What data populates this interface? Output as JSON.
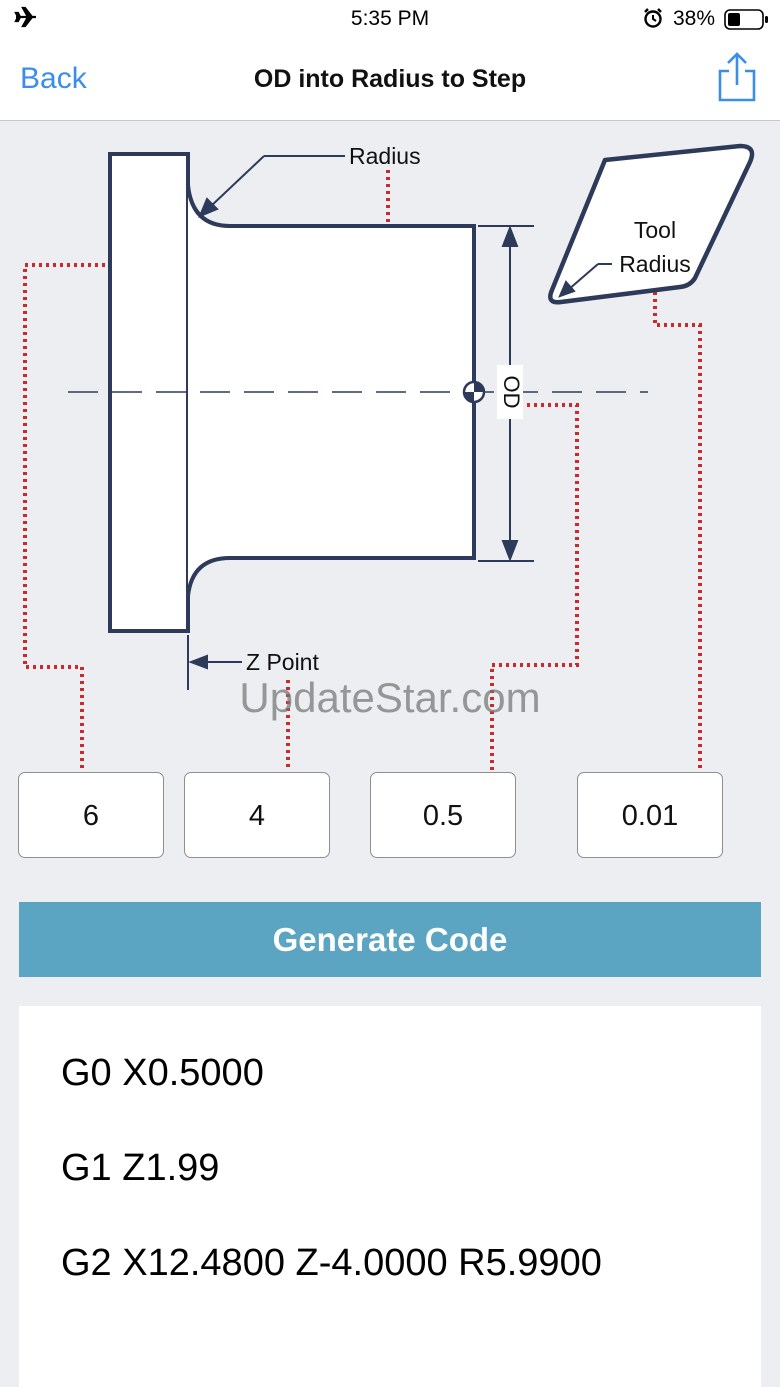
{
  "status_bar": {
    "time": "5:35 PM",
    "battery_percent": "38%",
    "battery_level": 0.38,
    "icons": [
      "airplane-icon",
      "alarm-icon",
      "battery-icon"
    ]
  },
  "nav": {
    "back_label": "Back",
    "title": "OD into Radius to Step",
    "share_icon": "share-icon",
    "accent_color": "#3a8ee6"
  },
  "diagram": {
    "labels": {
      "radius": "Radius",
      "tool": "Tool",
      "tool_radius": "Radius",
      "od": "OD",
      "z_point": "Z Point"
    },
    "line_color": "#2e3a59",
    "leader_color": "#cc2a2a"
  },
  "inputs": [
    {
      "value": "6"
    },
    {
      "value": "4"
    },
    {
      "value": "0.5"
    },
    {
      "value": "0.01"
    }
  ],
  "watermark": "UpdateStar.com",
  "generate_button": {
    "label": "Generate Code",
    "color": "#5ba5c2"
  },
  "output": {
    "lines": [
      "G0 X0.5000",
      "G1 Z1.99",
      "G2 X12.4800 Z-4.0000 R5.9900"
    ]
  }
}
